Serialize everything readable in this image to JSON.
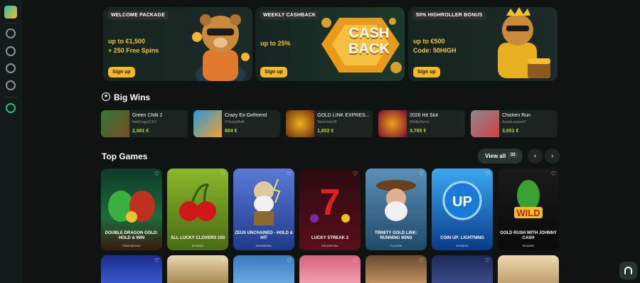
{
  "sidebar": {
    "items": [
      "logo-icon",
      "globe-icon",
      "coin-icon",
      "dice-icon",
      "gamepad-icon",
      "headset-icon"
    ]
  },
  "promos": [
    {
      "badge": "WELCOME PACKAGE",
      "line1": "up to €1,500",
      "line2": "+ 250 Free Spins",
      "button": "Sign up"
    },
    {
      "badge": "WEEKLY CASHBACK",
      "line1": "up to 25%",
      "line2": "",
      "button": "Sign up",
      "art_text_1": "CASH",
      "art_text_2": "BACK"
    },
    {
      "badge": "50% HIGHROLLER BONUS",
      "line1": "up to €500",
      "line2": "Code: 50HIGH",
      "button": "Sign up"
    }
  ],
  "big_wins": {
    "title": "Big Wins",
    "items": [
      {
        "game": "Green Chilli 2",
        "user": "NebDogg1CFC",
        "amount": "2,681 €",
        "color": "#2f7a3a"
      },
      {
        "game": "Crazy Ex-Girlfriend",
        "user": "47luckyMoth",
        "amount": "604 €",
        "color": "#2b9ad8"
      },
      {
        "game": "GOLD LINK EXPRES...",
        "user": "TameVole28",
        "amount": "1,652 €",
        "color": "#8a3a12"
      },
      {
        "game": "2026 Hit Slot",
        "user": "9WittyHeron",
        "amount": "3,765 €",
        "color": "#9a1a3a"
      },
      {
        "game": "Chicken Run",
        "user": "AcuteLeopard7",
        "amount": "3,651 €",
        "color": "#6a6a72"
      }
    ]
  },
  "top_games": {
    "title": "Top Games",
    "view_all": "View all",
    "count": "32",
    "cards": [
      {
        "title": "DOUBLE DRAGON GOLD: HOLD & WIN",
        "provider": "PENGUIN KING",
        "bg1": "#0f3a2a",
        "bg2": "#1d6b3a"
      },
      {
        "title": "ALL LUCKY CLOVERS 100",
        "provider": "BGAMING",
        "bg1": "#4a6a14",
        "bg2": "#8bb82a"
      },
      {
        "title": "ZEUS UNCHAINED - HOLD & HIT",
        "provider": "SPINOMENAL",
        "bg1": "#1f3a8a",
        "bg2": "#5a7ad8"
      },
      {
        "title": "LUCKY STREAK 3",
        "provider": "ENDORPHINA",
        "bg1": "#5a0f1a",
        "bg2": "#c0301f"
      },
      {
        "title": "TRINITY GOLD LINK: RUNNING WINS",
        "provider": "PLAYSON",
        "bg1": "#1f4a6a",
        "bg2": "#5a90b8"
      },
      {
        "title": "COIN UP: LIGHTNING",
        "provider": "BOOMING",
        "bg1": "#0a3a8a",
        "bg2": "#3aa8f0"
      },
      {
        "title": "GOLD RUSH WITH JOHNNY CASH",
        "provider": "BGAMING",
        "bg1": "#0a0a0a",
        "bg2": "#2a1a10"
      }
    ],
    "row2": [
      {
        "bg1": "#1a2a8a",
        "bg2": "#3a5ad0"
      },
      {
        "bg1": "#e8d8b0",
        "bg2": "#a88a50"
      },
      {
        "bg1": "#3a7ac0",
        "bg2": "#6aa8e0"
      },
      {
        "bg1": "#d8607a",
        "bg2": "#f0a0b0"
      },
      {
        "bg1": "#6a4a30",
        "bg2": "#c09060"
      },
      {
        "bg1": "#1a2a5a",
        "bg2": "#3a4a8a"
      },
      {
        "bg1": "#f0d8b0",
        "bg2": "#c0a070"
      }
    ]
  },
  "colors": {
    "accent": "#f7b924",
    "win": "#a6d93b",
    "bg": "#0f1413"
  }
}
